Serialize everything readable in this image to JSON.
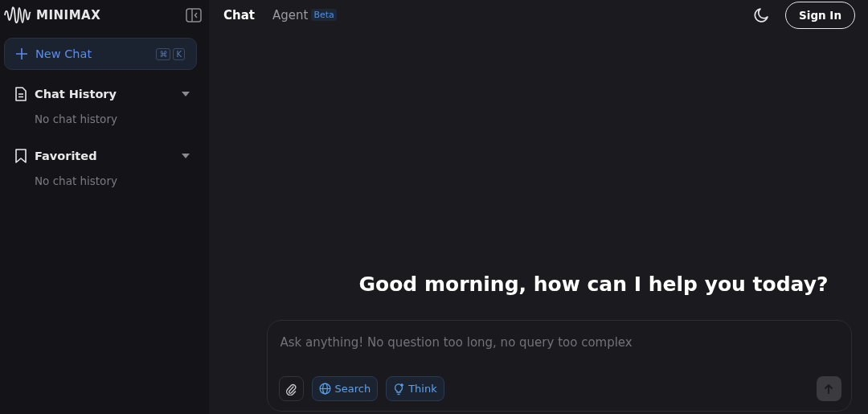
{
  "sidebar": {
    "logo": "MINIMAX",
    "new_chat": {
      "label": "New Chat",
      "shortcut": [
        "⌘",
        "K"
      ]
    },
    "sections": [
      {
        "kind": "history",
        "title": "Chat History",
        "expanded": true,
        "empty_text": "No chat history"
      },
      {
        "kind": "favorites",
        "title": "Favorited",
        "expanded": true,
        "empty_text": "No chat history"
      }
    ]
  },
  "tabs": [
    {
      "label": "Chat",
      "selected": true
    },
    {
      "label": "Agent",
      "selected": false,
      "badge": "Beta"
    }
  ],
  "sign_in": "Sign In",
  "greeting": "Good morning, how can I help you today?",
  "composer": {
    "placeholder": "Ask anything! No question too long, no query too complex",
    "toggles": [
      {
        "kind": "search",
        "label": "Search",
        "on": true
      },
      {
        "kind": "think",
        "label": "Think",
        "on": true
      }
    ],
    "send_disabled": true
  }
}
